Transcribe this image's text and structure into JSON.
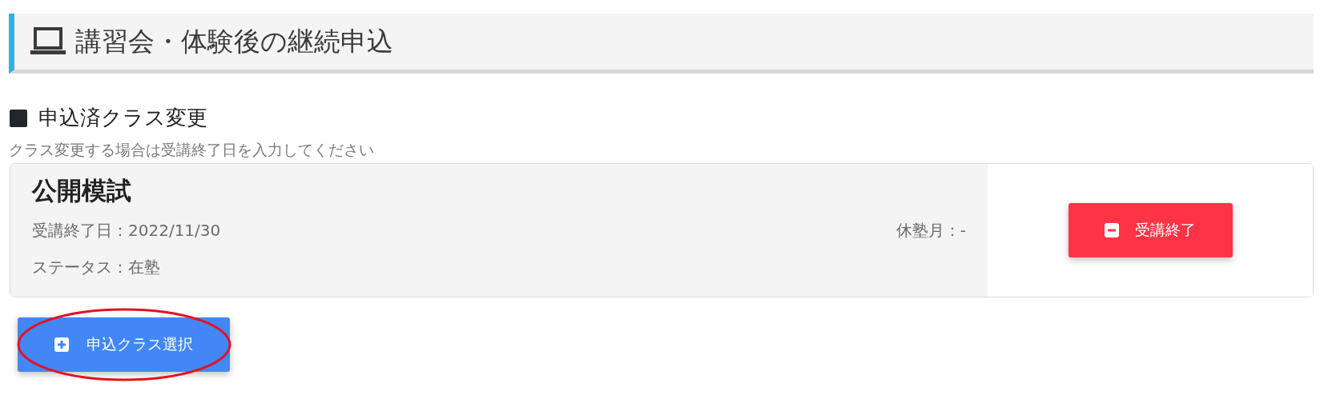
{
  "page_header": {
    "title": "講習会・体験後の継続申込"
  },
  "section": {
    "heading": "申込済クラス変更",
    "hint": "クラス変更する場合は受講終了日を入力してください"
  },
  "class_card": {
    "title": "公開模試",
    "end_date": "受講終了日：2022/11/30",
    "suspension_month": "休塾月：-",
    "status": "ステータス：在塾",
    "end_button": "受講終了"
  },
  "add_button": "申込クラス選択"
}
